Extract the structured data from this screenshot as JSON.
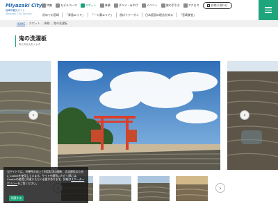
{
  "header": {
    "logo_main": "Miyazaki City",
    "logo_sub": "宮崎市観光サイト",
    "logo_en": "Miyazaki City Tourism",
    "util": [
      {
        "label": "特集",
        "icon": "star-icon",
        "active": false
      },
      {
        "label": "モデルコース",
        "icon": "route-icon",
        "active": false
      },
      {
        "label": "スポット",
        "icon": "spot-icon",
        "active": true
      },
      {
        "label": "体験",
        "icon": "experience-icon",
        "active": false
      },
      {
        "label": "グルメ・みやげ",
        "icon": "gourmet-icon",
        "active": false
      },
      {
        "label": "イベント",
        "icon": "event-icon",
        "active": false
      },
      {
        "label": "旅の手引き",
        "icon": "guide-icon",
        "active": false
      },
      {
        "label": "アクセス",
        "icon": "access-icon",
        "active": false
      }
    ],
    "contact_label": "お問い合わせ",
    "nav": [
      "初めての宮崎",
      "「青島エリア」",
      "「一ツ葉エリア」",
      "遊ぼうクーポン",
      "日本庭園の理念を知る",
      "「宮崎食堂」"
    ]
  },
  "breadcrumb": {
    "home": "HOME",
    "items": [
      "スポット",
      "体験",
      "鬼の洗濯板"
    ]
  },
  "title": {
    "main": "鬼の洗濯板",
    "reading": "おにのせんたくいた"
  },
  "cookie": {
    "text": "当サイトでは、利便性の向上と利用状況の解析、広告配信のためにCookieを使用しています。サイトを閲覧いただく際には、Cookieの使用に同意いただく必要があります。詳細は",
    "link": "スクーターポリシー",
    "text_tail": "をご覧ください。",
    "button": "同意する"
  },
  "colors": {
    "accent": "#1fa57c",
    "link": "#2b6db0"
  }
}
